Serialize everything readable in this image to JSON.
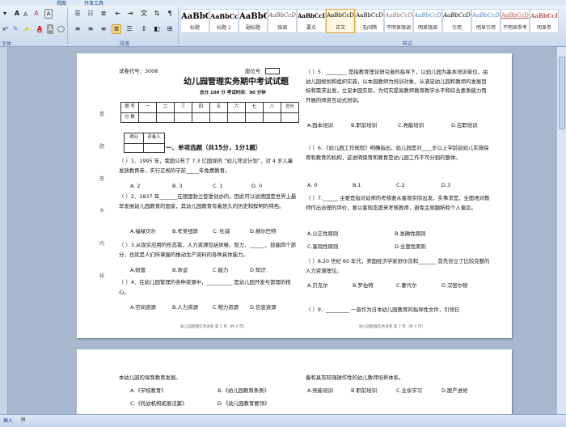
{
  "ribbon": {
    "tabs": [
      "视图",
      "开发工具"
    ],
    "font_buttons": {
      "grow": "A",
      "shrink": "A",
      "clear": "A",
      "char_shading": "A",
      "bold": "B",
      "italic": "I",
      "underline": "U",
      "strike": "abc",
      "subscript": "x₂",
      "superscript": "x²"
    },
    "group_labels": {
      "font": "字体",
      "paragraph": "段落",
      "styles": "样式"
    },
    "styles": [
      {
        "sample": "AaBbC",
        "name": "标题"
      },
      {
        "sample": "AaBbCcD",
        "name": "标题 1"
      },
      {
        "sample": "AaBbC",
        "name": "副标题"
      },
      {
        "sample": "AaBbCcD",
        "name": "强调"
      },
      {
        "sample": "AaBbCcD",
        "name": "要点"
      },
      {
        "sample": "AaBbCcD",
        "name": "正文"
      },
      {
        "sample": "AaBbCcD",
        "name": "无间隔"
      },
      {
        "sample": "AaBbCcD",
        "name": "不明显强调"
      },
      {
        "sample": "AaBbCcD",
        "name": "明显强调"
      },
      {
        "sample": "AaBbCcD",
        "name": "引用"
      },
      {
        "sample": "AaBbCcD",
        "name": "明显引用"
      },
      {
        "sample": "AaBbCcD",
        "name": "不明显参考"
      },
      {
        "sample": "AaBbCcD",
        "name": "明显参"
      }
    ]
  },
  "page1": {
    "exam_code": "试卷代号：3008",
    "seat": "座位号",
    "title": "幼儿园管理实务期中考试试题",
    "subtitle": "总分 100 分     考试时间：90 分钟",
    "score_row1": [
      "题 号",
      "一",
      "二",
      "三",
      "四",
      "五",
      "六",
      "七",
      "八",
      "总分"
    ],
    "score_row2": [
      "分 数"
    ],
    "mini_table": [
      "得分",
      "评卷人"
    ],
    "section_title": "一、单项选题（共15分，1分1题）",
    "left_questions": [
      "（ ）1．1995 年，我国公布了 7.3 亿国视的 “幼儿凭证计划”，对 4 岁儿童发放教育券，实行正规的学前_____年免费教育。",
      "（ ）2．1837 年_______在德国勃兰登堡创办的，因此可以说德国是世界上最早发展幼儿园教育的国家，其幼儿园教育有着悠久的历史和鲜明的特色。",
      "（ ）3.从现实应用的形态看，人力资源包括体格、智力、______、技能四个部分，也就是人们所掌握的推动生产资料的各种具体能力。",
      "（ ）4．在幼儿园管理的各种资源中，__________ 是幼儿园开发与管理的核心。"
    ],
    "left_options": [
      [
        "A. 2",
        "B. 3",
        "C. 1",
        "D. 0"
      ],
      [
        "A.福禄贝尔",
        "B.考美纽斯",
        "C. 杜威",
        "D.赫尔巴特"
      ],
      [
        "A.财富",
        "B.命运",
        "C.能力",
        "D.知识"
      ],
      [
        "A.空间资源",
        "B.人力资源",
        "C.物力资源",
        "D.信息资源"
      ]
    ],
    "right_questions": [
      "（ ）5．________ 是指教育理论研究者的指导下，以幼儿园为基本培训单位，由幼儿园规划和组织实施，以本园教师为培训对象，从满足幼儿园和教师的发展目标和需求出发，立足本园实际，为切实提高教师教育教学水平和综合素质能力而开展的师资互动式培训。",
      "（ ）6．《幼儿园工作规程》明确指出，幼儿园是对____岁以上学龄前幼儿实施保育和教育的机构，这说明保育和教育是幼儿园工作不可分割的整体。",
      "（ ）7.______ 主要是指对幼师的考核要从客观实际出发，实事求是，全面地对教师作出合理的评价，要以客观态度来考核教师，避免主观臆断和个人偏见。",
      "（ ）8.20 世纪 60 年代，美国经济学家舒尔茨和_______ 首先创立了比较完整的人力资源理论。",
      "（ ）9．_________ 一直作为日本幼儿园教育的指导性文件，引领日"
    ],
    "right_options": [
      [
        "A.园本培训",
        "B.职前培训",
        "C.亮能培训",
        "D.在职培训"
      ],
      [
        "A. 0",
        "B.1",
        "C.2",
        "D.3"
      ],
      [
        "A.公正性原则",
        "B.准确性原则",
        "C.客观性原则",
        "D.全面性原则"
      ],
      [
        "A.贝克尔",
        "B.罗伯特",
        "C.蒙代尔",
        "D.汉密尔顿"
      ]
    ],
    "footer_left": "幼儿园管理实务试卷  第 1 页（共 4 页）",
    "footer_right": "幼儿园管理实务试卷  第 2 页（共 4 页）",
    "side_labels": [
      "卷",
      "题",
      "答",
      "不",
      "内",
      "线"
    ]
  },
  "page2": {
    "left_text": "本幼儿园的保育教育发展。",
    "left_options": [
      [
        "A.《学校教育》",
        "B.《幼儿园教育条例》"
      ],
      [
        "C.《托幼机构拓展法案》",
        "D.《幼儿园教育要领》"
      ]
    ],
    "right_text": "备和具有较强操作性的幼儿教师培养体系。",
    "right_options": [
      "A.亮能培训",
      "B.职前培训",
      "C.业余学习",
      "D.脱产进修"
    ]
  },
  "status": {
    "left": "插入"
  }
}
